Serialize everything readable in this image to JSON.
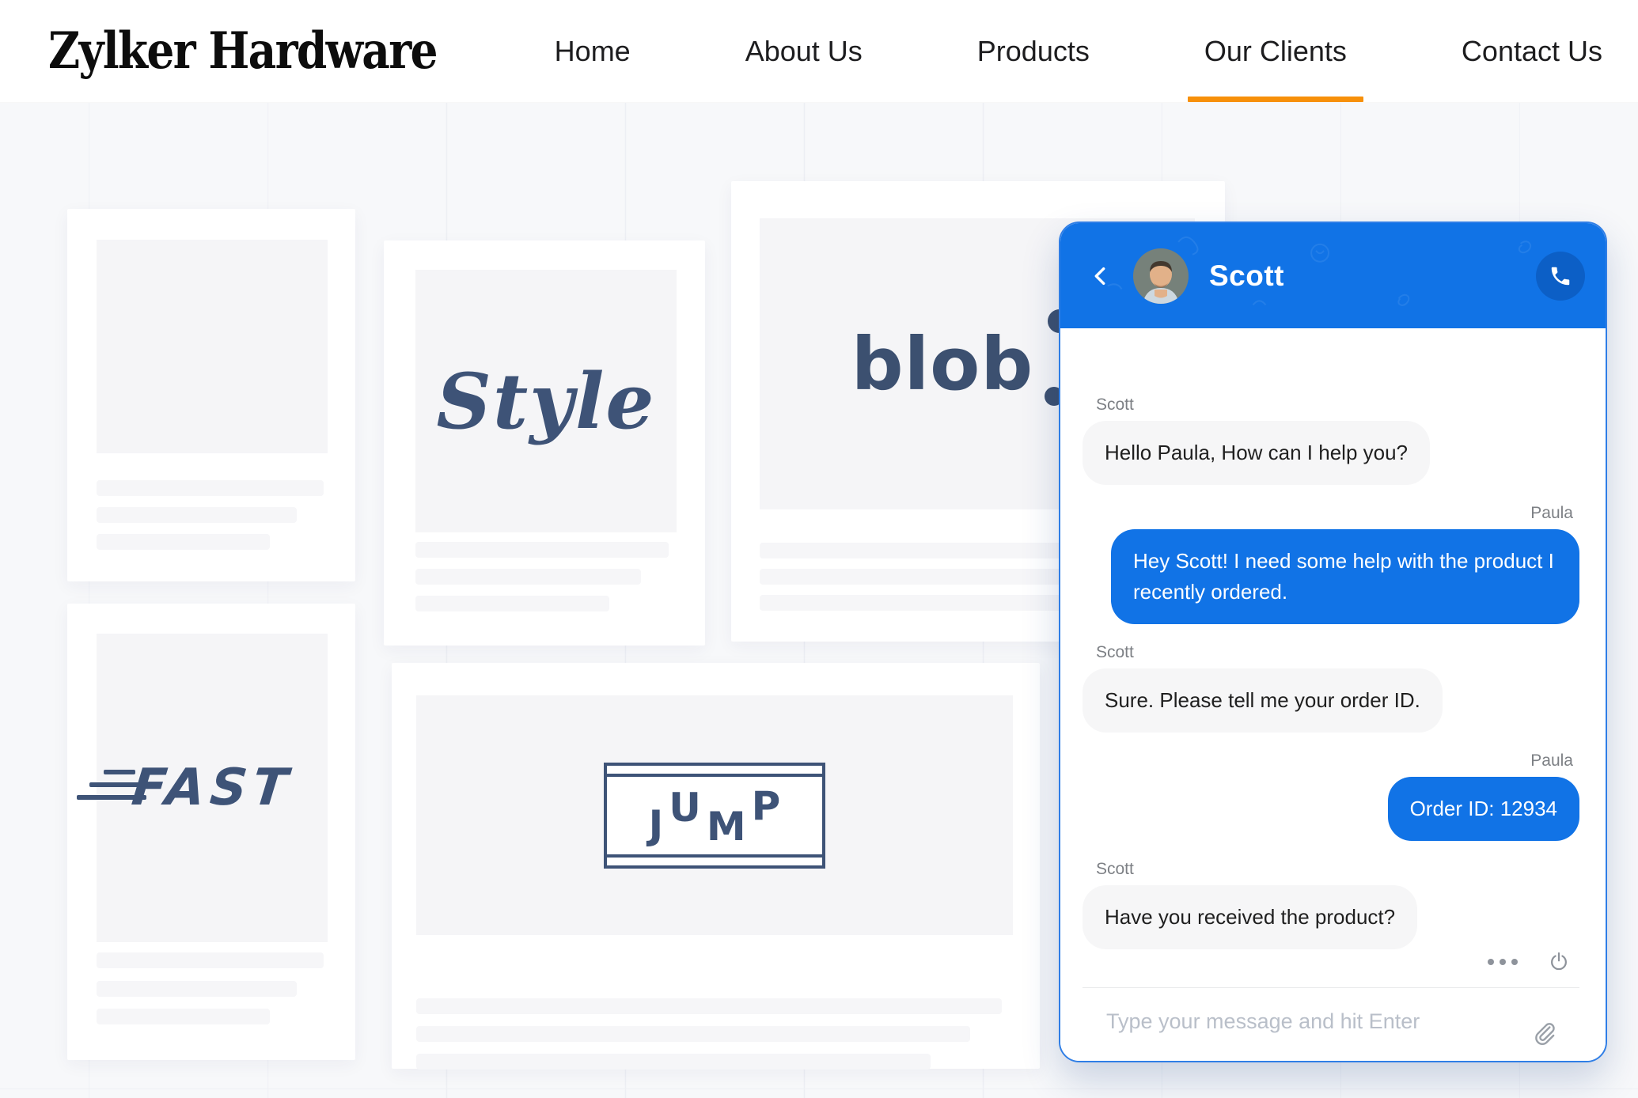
{
  "page": {
    "background": "#f7f8fa",
    "accent_orange": "#F7900A",
    "brand_navy": "#3E5377",
    "chat_blue": "#1173E6"
  },
  "header": {
    "logo": "Zylker Hardware",
    "nav": {
      "items": [
        {
          "label": "Home",
          "active": false
        },
        {
          "label": "About Us",
          "active": false
        },
        {
          "label": "Products",
          "active": false
        },
        {
          "label": "Our Clients",
          "active": true
        },
        {
          "label": "Contact Us",
          "active": false
        }
      ]
    }
  },
  "clients": {
    "cards": [
      {
        "name": "empty-card",
        "logo_text": ""
      },
      {
        "name": "style-card",
        "logo_text": "Style"
      },
      {
        "name": "blob-card",
        "logo_text": "blob"
      },
      {
        "name": "fast-card",
        "logo_text": "FAST"
      },
      {
        "name": "jump-card",
        "letters": [
          "J",
          "U",
          "M",
          "P"
        ]
      }
    ]
  },
  "chat": {
    "title": "Scott",
    "icons": {
      "back": "back-chevron-icon",
      "call": "phone-icon",
      "more": "more-options-icon",
      "power": "power-icon",
      "attach": "paperclip-icon"
    },
    "messages": [
      {
        "sender": "Scott",
        "side": "left",
        "text": "Hello Paula, How can I help you?"
      },
      {
        "sender": "Paula",
        "side": "right",
        "text": "Hey Scott! I need some help with the product I recently ordered."
      },
      {
        "sender": "Scott",
        "side": "left",
        "text": "Sure. Please tell me your order ID."
      },
      {
        "sender": "Paula",
        "side": "right",
        "text": "Order ID: 12934"
      },
      {
        "sender": "Scott",
        "side": "left",
        "text": "Have you received the product?"
      }
    ],
    "input": {
      "placeholder": "Type your message and hit Enter"
    }
  }
}
